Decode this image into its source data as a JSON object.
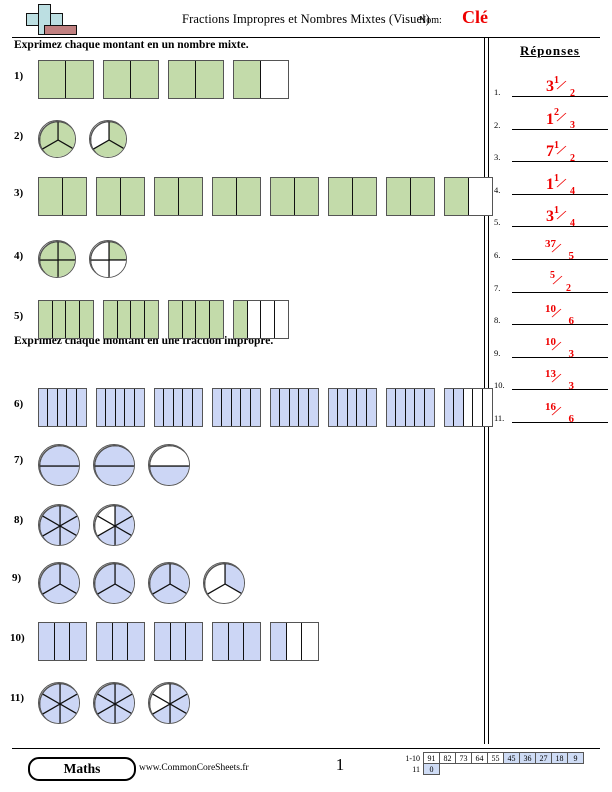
{
  "header": {
    "title": "Fractions Impropres et Nombres Mixtes (Visuel)",
    "name_label": "Nom:",
    "name_value": "Clé",
    "logo_icon": "plus-block-logo"
  },
  "sections": [
    {
      "id": "section-1",
      "instruction": "Exprimez chaque montant en un nombre mixte."
    },
    {
      "id": "section-2",
      "instruction": "Exprimez chaque montant en une fraction impropre."
    }
  ],
  "problems": [
    {
      "number": "1)",
      "shape": "rect",
      "parts": 2,
      "models": [
        2,
        2,
        2,
        1
      ],
      "color": "#c3dbaa"
    },
    {
      "number": "2)",
      "shape": "circle",
      "parts": 3,
      "models": [
        3,
        2
      ],
      "color": "#c3dbaa"
    },
    {
      "number": "3)",
      "shape": "rect",
      "parts": 2,
      "models": [
        2,
        2,
        2,
        2,
        2,
        2,
        2,
        1
      ],
      "color": "#c3dbaa"
    },
    {
      "number": "4)",
      "shape": "circle",
      "parts": 4,
      "models": [
        4,
        1
      ],
      "color": "#c3dbaa"
    },
    {
      "number": "5)",
      "shape": "rect",
      "parts": 4,
      "models": [
        4,
        4,
        4,
        1
      ],
      "color": "#c3dbaa"
    },
    {
      "number": "6)",
      "shape": "rect",
      "parts": 5,
      "models": [
        5,
        5,
        5,
        5,
        5,
        5,
        5,
        2
      ],
      "color": "#ccd6f5"
    },
    {
      "number": "7)",
      "shape": "circle",
      "parts": 2,
      "models": [
        2,
        2,
        1
      ],
      "color": "#ccd6f5"
    },
    {
      "number": "8)",
      "shape": "circle",
      "parts": 6,
      "models": [
        6,
        4
      ],
      "color": "#ccd6f5"
    },
    {
      "number": "9)",
      "shape": "circle",
      "parts": 3,
      "models": [
        3,
        3,
        3,
        1
      ],
      "color": "#ccd6f5"
    },
    {
      "number": "10)",
      "shape": "rect",
      "parts": 3,
      "models": [
        3,
        3,
        3,
        3,
        1
      ],
      "color": "#ccd6f5"
    },
    {
      "number": "11)",
      "shape": "circle",
      "parts": 6,
      "models": [
        6,
        6,
        4
      ],
      "color": "#ccd6f5"
    }
  ],
  "answers": {
    "title": "Réponses",
    "items": [
      {
        "index": "1.",
        "whole": "3",
        "numerator": "1",
        "denominator": "2"
      },
      {
        "index": "2.",
        "whole": "1",
        "numerator": "2",
        "denominator": "3"
      },
      {
        "index": "3.",
        "whole": "7",
        "numerator": "1",
        "denominator": "2"
      },
      {
        "index": "4.",
        "whole": "1",
        "numerator": "1",
        "denominator": "4"
      },
      {
        "index": "5.",
        "whole": "3",
        "numerator": "1",
        "denominator": "4"
      },
      {
        "index": "6.",
        "whole": "",
        "numerator": "37",
        "denominator": "5"
      },
      {
        "index": "7.",
        "whole": "",
        "numerator": "5",
        "denominator": "2"
      },
      {
        "index": "8.",
        "whole": "",
        "numerator": "10",
        "denominator": "6"
      },
      {
        "index": "9.",
        "whole": "",
        "numerator": "10",
        "denominator": "3"
      },
      {
        "index": "10.",
        "whole": "",
        "numerator": "13",
        "denominator": "3"
      },
      {
        "index": "11.",
        "whole": "",
        "numerator": "16",
        "denominator": "6"
      }
    ]
  },
  "footer": {
    "subject": "Maths",
    "url": "www.CommonCoreSheets.fr",
    "page": "1",
    "score_rows": [
      {
        "label": "1-10",
        "cells": [
          {
            "value": "91",
            "shaded": false
          },
          {
            "value": "82",
            "shaded": false
          },
          {
            "value": "73",
            "shaded": false
          },
          {
            "value": "64",
            "shaded": false
          },
          {
            "value": "55",
            "shaded": false
          },
          {
            "value": "45",
            "shaded": true
          },
          {
            "value": "36",
            "shaded": true
          },
          {
            "value": "27",
            "shaded": true
          },
          {
            "value": "18",
            "shaded": true
          },
          {
            "value": "9",
            "shaded": true
          }
        ]
      },
      {
        "label": "11",
        "cells": [
          {
            "value": "0",
            "shaded": true
          }
        ]
      }
    ]
  },
  "colors": {
    "answer_red": "#ee0000",
    "green_fill": "#c3dbaa",
    "blue_fill": "#ccd6f5",
    "score_shade": "#cfdcf5"
  }
}
